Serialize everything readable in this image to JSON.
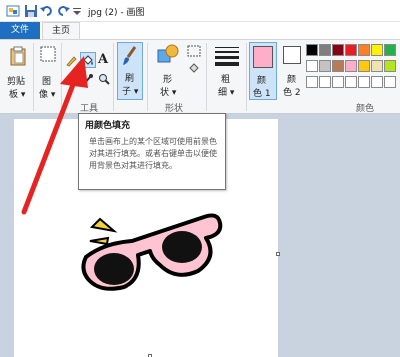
{
  "titlebar": {
    "title": "jpg (2) - 画图",
    "icons": [
      "paint-app-icon",
      "save-icon",
      "undo-icon",
      "redo-icon",
      "customize-dropdown-icon"
    ]
  },
  "tabs": {
    "file": "文件",
    "home": "主页"
  },
  "ribbon": {
    "clipboard": {
      "paste_label_1": "剪贴",
      "paste_label_2": "板 ▾"
    },
    "image": {
      "label_1": "图",
      "label_2": "像 ▾"
    },
    "tools": {
      "group_label": "工具",
      "text_tool": "A"
    },
    "brush": {
      "label_1": "刷",
      "label_2": "子 ▾"
    },
    "shapes": {
      "label_1": "形",
      "label_2": "状 ▾",
      "group_label": "形状"
    },
    "size": {
      "label_1": "粗",
      "label_2": "细 ▾"
    },
    "color1": {
      "label_1": "颜",
      "label_2": "色 1"
    },
    "color2": {
      "label_1": "颜",
      "label_2": "色 2"
    },
    "colors": {
      "group_label": "颜色"
    },
    "palette_row1": [
      "#000000",
      "#7f7f7f",
      "#880015",
      "#ed1c24",
      "#ff7f27",
      "#fff200",
      "#22b14c"
    ],
    "palette_row2": [
      "#ffffff",
      "#c3c3c3",
      "#b97a57",
      "#ffaec9",
      "#ffc90e",
      "#efe4b0",
      "#b5e61d"
    ],
    "palette_row3": [
      "#ffffff",
      "#ffffff",
      "#ffffff",
      "#ffffff",
      "#ffffff",
      "#ffffff",
      "#ffffff"
    ],
    "accent": "#1e6fbf",
    "color1_value": "#ffaec9"
  },
  "tooltip": {
    "title": "用颜色填充",
    "body": "单击画布上的某个区域可使用前景色对其进行填充。或者右键单击以便使用背景色对其进行填充。"
  }
}
